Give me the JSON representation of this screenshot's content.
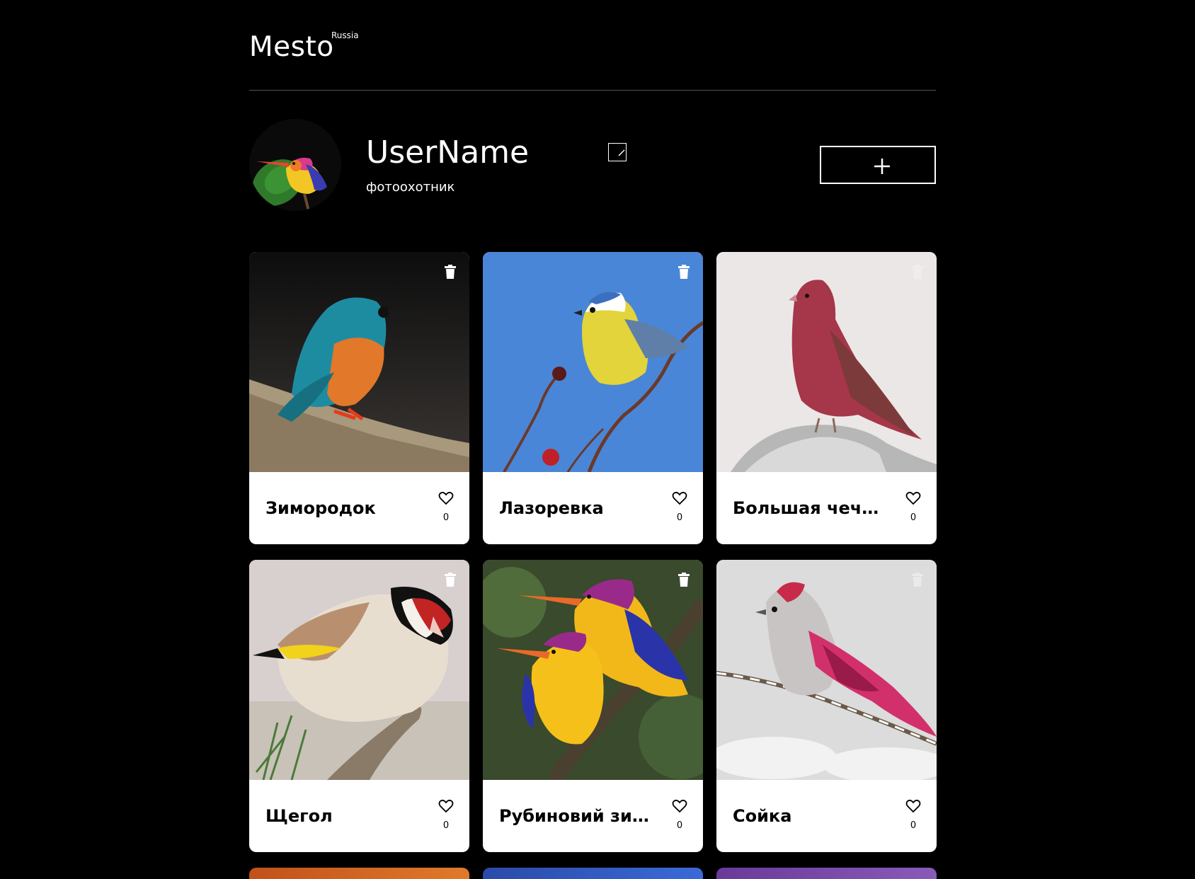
{
  "header": {
    "logo": "Mesto",
    "logo_superscript": "Russia"
  },
  "profile": {
    "name": "UserName",
    "about": "фотоохотник",
    "avatar_icon": "kingfisher-avatar"
  },
  "colors": {
    "background": "#000000",
    "card": "#ffffff",
    "text_dark": "#000000",
    "divider": "#545454"
  },
  "cards": [
    {
      "title": "Зимородок",
      "likes": "0",
      "owned": true
    },
    {
      "title": "Лазоревка",
      "likes": "0",
      "owned": true
    },
    {
      "title": "Большая чечевица",
      "likes": "0",
      "owned": false
    },
    {
      "title": "Щегол",
      "likes": "0",
      "owned": true
    },
    {
      "title": "Рубиновий зимородок",
      "likes": "0",
      "owned": true
    },
    {
      "title": "Сойка",
      "likes": "0",
      "owned": false
    }
  ]
}
